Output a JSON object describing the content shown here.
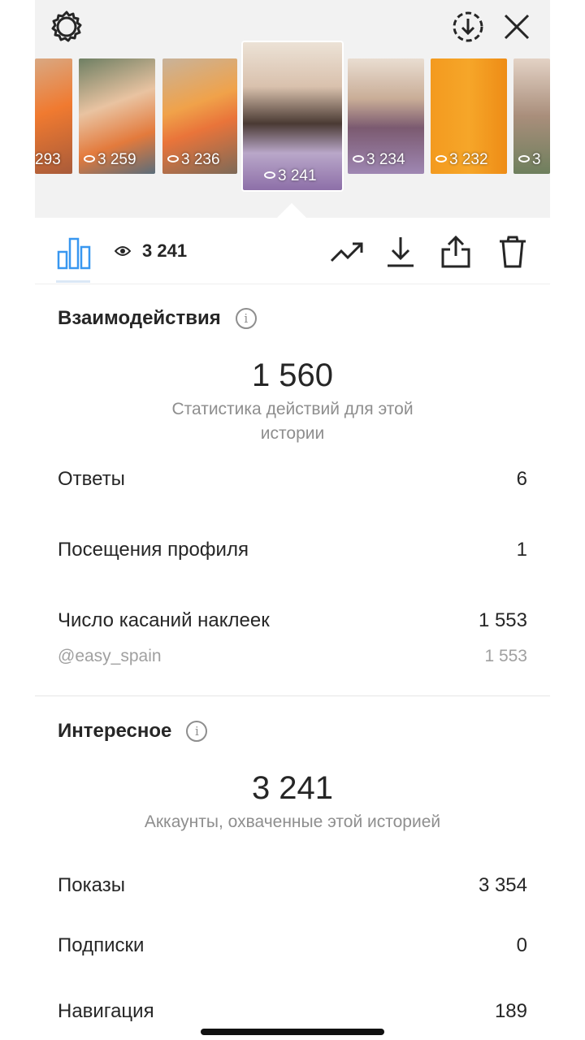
{
  "header": {
    "settings_icon": "settings-gear-icon",
    "save_icon": "download-circle-icon",
    "close_icon": "close-icon"
  },
  "stories": [
    {
      "views": "293"
    },
    {
      "views": "3 259"
    },
    {
      "views": "3 236"
    },
    {
      "views": "3 241",
      "selected": true
    },
    {
      "views": "3 234"
    },
    {
      "views": "3 232"
    },
    {
      "views": "3"
    }
  ],
  "toolbar": {
    "views": "3 241",
    "icons": [
      "bar-chart-icon",
      "eye-icon",
      "trending-up-icon",
      "download-icon",
      "share-icon",
      "trash-icon"
    ]
  },
  "interactions": {
    "title": "Взаимодействия",
    "total": "1 560",
    "subtitle": "Статистика действий для этой истории",
    "rows": [
      {
        "label": "Ответы",
        "value": "6"
      },
      {
        "label": "Посещения профиля",
        "value": "1"
      },
      {
        "label": "Число касаний наклеек",
        "value": "1 553"
      }
    ],
    "sub_row": {
      "label": "@easy_spain",
      "value": "1 553"
    }
  },
  "discovery": {
    "title": "Интересное",
    "total": "3 241",
    "subtitle": "Аккаунты, охваченные этой историей",
    "rows": [
      {
        "label": "Показы",
        "value": "3 354"
      },
      {
        "label": "Подписки",
        "value": "0"
      },
      {
        "label": "Навигация",
        "value": "189"
      }
    ]
  },
  "colors": {
    "accent_blue": "#3897f0",
    "text": "#262626",
    "secondary": "#8e8e8e"
  }
}
